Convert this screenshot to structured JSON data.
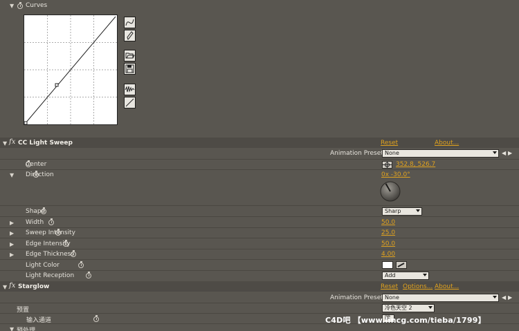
{
  "curves": {
    "label": "Curves",
    "points": [
      [
        0,
        0
      ],
      [
        0.35,
        0.35
      ],
      [
        1,
        1
      ]
    ]
  },
  "cc_light_sweep": {
    "title": "CC Light Sweep",
    "reset": "Reset",
    "about": "About...",
    "animation_presets_label": "Animation Presets:",
    "animation_presets_value": "None",
    "properties": {
      "center": {
        "label": "Center",
        "value": "352.8, 526.7"
      },
      "direction": {
        "label": "Direction",
        "value": "0x -30.0°",
        "dial_degrees": -30
      },
      "shape": {
        "label": "Shape",
        "value": "Sharp"
      },
      "width": {
        "label": "Width",
        "value": "50.0"
      },
      "sweep_intensity": {
        "label": "Sweep Intensity",
        "value": "25.0"
      },
      "edge_intensity": {
        "label": "Edge Intensity",
        "value": "50.0"
      },
      "edge_thickness": {
        "label": "Edge Thickness",
        "value": "4.00"
      },
      "light_color": {
        "label": "Light Color",
        "swatch": "#ffffff"
      },
      "light_reception": {
        "label": "Light Reception",
        "value": "Add"
      }
    }
  },
  "starglow": {
    "title": "Starglow",
    "reset": "Reset",
    "options": "Options...",
    "about": "About...",
    "animation_presets_label": "Animation Presets:",
    "animation_presets_value": "None",
    "preset_label": "预置",
    "preset_value": "冷色天空 2",
    "input_channel_label": "输入通道",
    "input_channel_value": "明",
    "pre_process_label": "预处理"
  },
  "watermark": "C4D吧 【www.lincg.com/tieba/1799】",
  "colors": {
    "accent": "#e0a21e",
    "panel": "#595650",
    "header": "#4e4b46"
  }
}
